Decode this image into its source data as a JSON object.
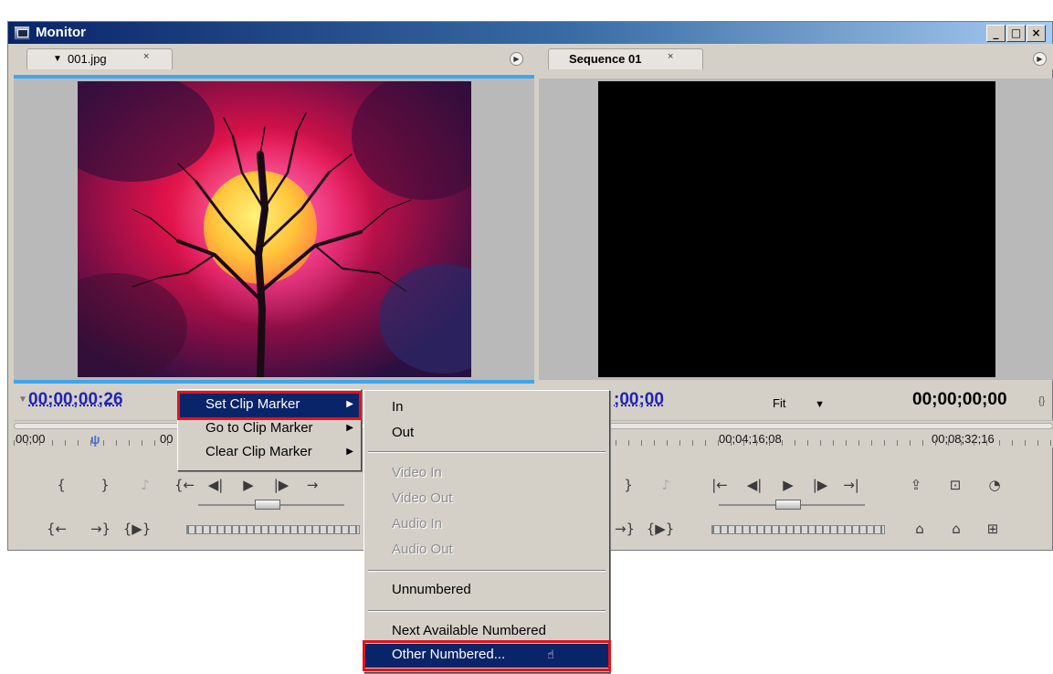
{
  "window": {
    "title": "Monitor",
    "controls": [
      "_",
      "□",
      "×"
    ]
  },
  "source_panel": {
    "tab_label": "001.jpg",
    "tab_close": "×",
    "timecode": "00;00;00;26",
    "ruler_labels": [
      "00;00",
      "00"
    ]
  },
  "program_panel": {
    "tab_label": "Sequence 01",
    "tab_close": "×",
    "timecode_left": ";00;00",
    "zoom": "Fit",
    "timecode_right": "00;00;00;00",
    "ruler_labels": [
      "00;04;16;08",
      "00;08;32;16"
    ]
  },
  "context_menu": {
    "items": [
      {
        "label": "Set Clip Marker",
        "submenu": true,
        "active": true
      },
      {
        "label": "Go to Clip Marker",
        "submenu": true
      },
      {
        "label": "Clear Clip Marker",
        "submenu": true
      }
    ]
  },
  "submenu": {
    "items": [
      {
        "label": "In",
        "enabled": true
      },
      {
        "label": "Out",
        "enabled": true
      },
      {
        "label": "Video In",
        "enabled": false
      },
      {
        "label": "Video Out",
        "enabled": false
      },
      {
        "label": "Audio In",
        "enabled": false
      },
      {
        "label": "Audio Out",
        "enabled": false
      },
      {
        "label": "Unnumbered",
        "enabled": true
      },
      {
        "label": "Next Available Numbered",
        "enabled": true
      },
      {
        "label": "Other Numbered...",
        "enabled": true,
        "highlighted": true
      }
    ]
  },
  "icons": {
    "source_controls_row1": [
      "{",
      "}",
      "♪",
      "{←",
      "◀|",
      "▶",
      "|▶",
      "→"
    ],
    "source_controls_row2": [
      "{←",
      "→}",
      "{▶}"
    ],
    "program_controls_row1": [
      "}",
      "♪",
      "|←",
      "◀|",
      "▶",
      "|▶",
      "→|",
      "⇪",
      "⊡",
      "◔"
    ],
    "program_controls_row2": [
      "→}",
      "{▶}",
      "⌂",
      "⌂",
      "⊞"
    ]
  },
  "colors": {
    "highlight": "#0a246a",
    "callout_box": "#e5121b",
    "timecode": "#1f23b8"
  }
}
